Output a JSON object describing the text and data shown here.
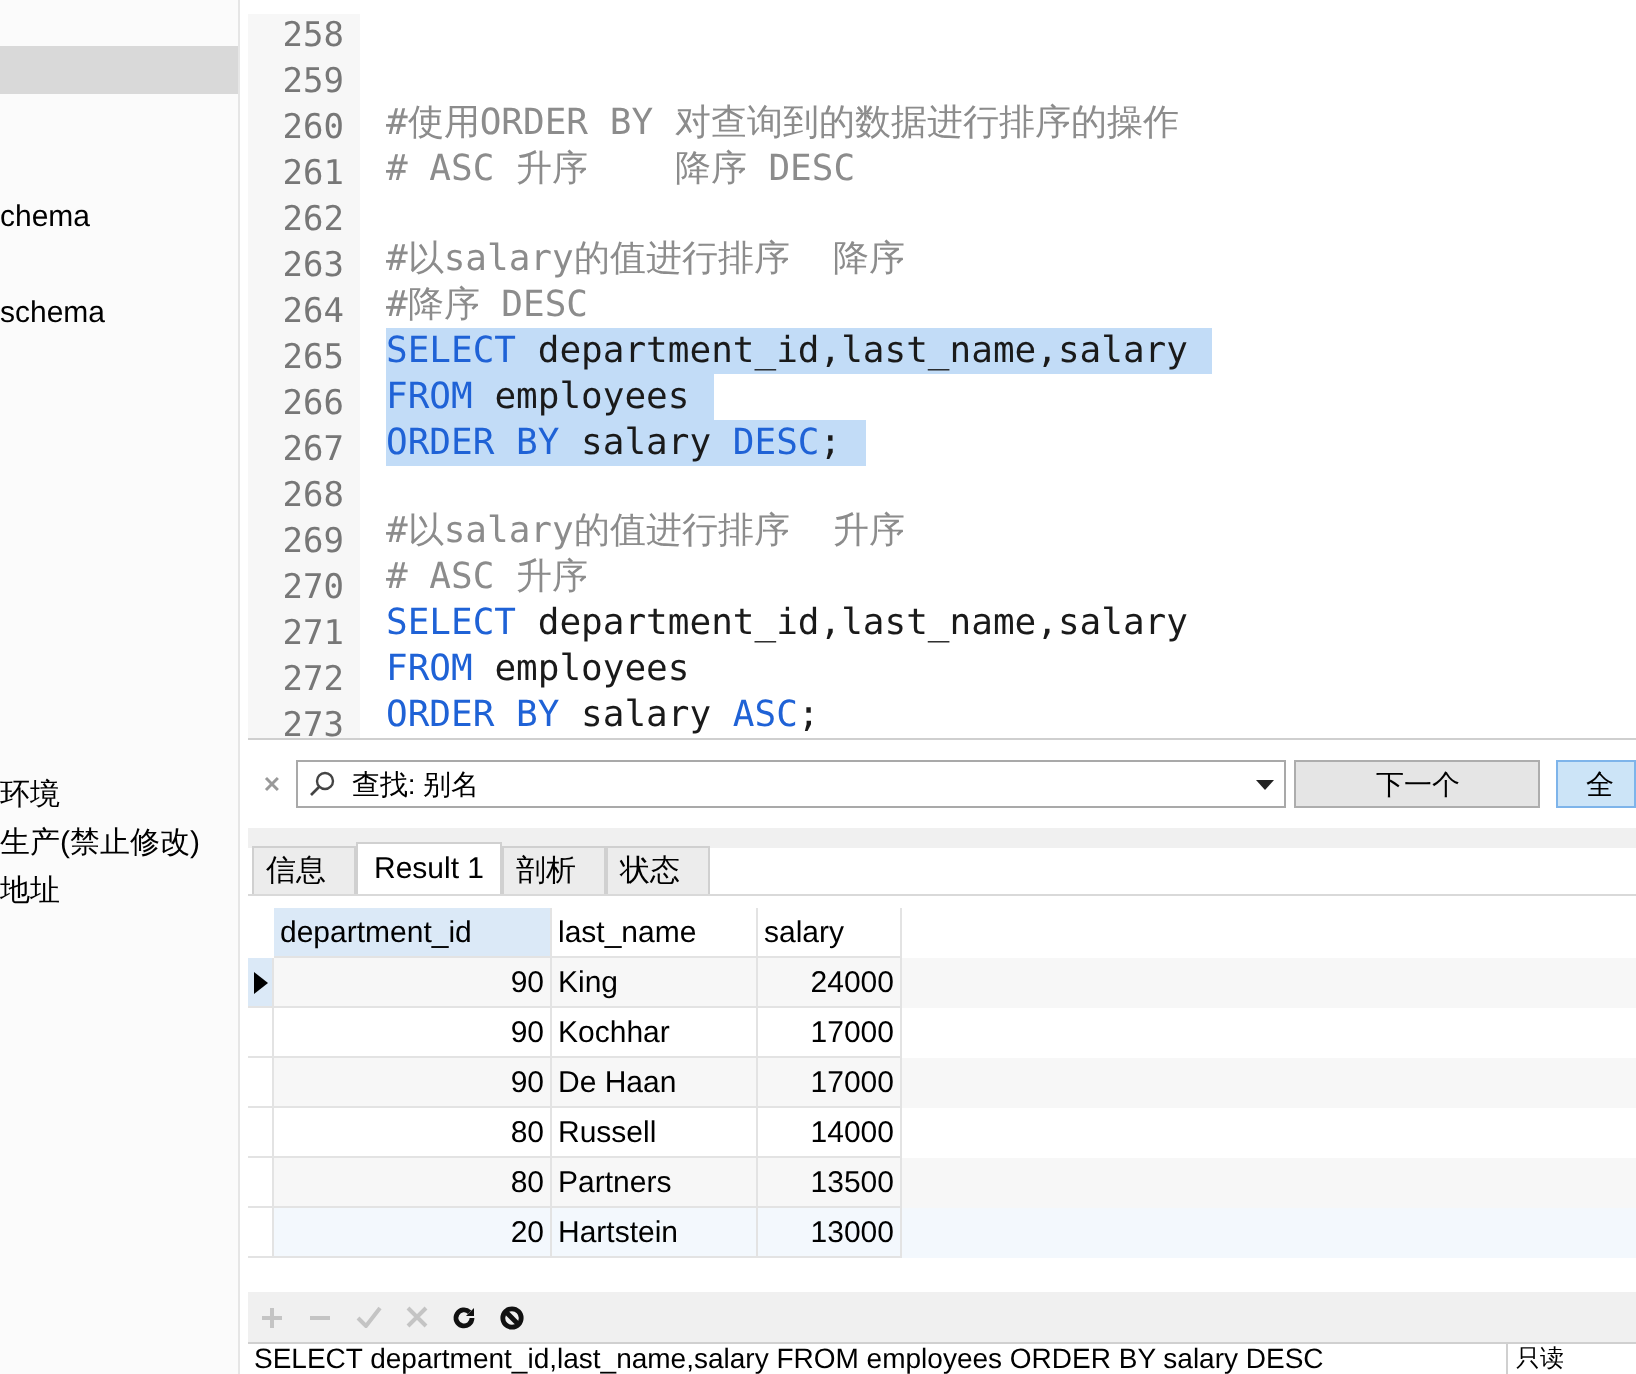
{
  "sidebar": {
    "items": [
      {
        "selected": true
      },
      {
        "label": "chema",
        "selected": false
      },
      {
        "label": "schema",
        "selected": false
      },
      {
        "label": "环境",
        "selected": false
      },
      {
        "label": "生产(禁止修改)",
        "selected": false
      },
      {
        "label": "地址",
        "selected": false
      }
    ]
  },
  "editor": {
    "lines": [
      {
        "number": "258"
      },
      {
        "number": "259"
      },
      {
        "number": "260",
        "selected": false,
        "tokens": [
          {
            "kind": "comment",
            "text": "#使用ORDER BY 对查询到的数据进行排序的操作"
          }
        ]
      },
      {
        "number": "261",
        "selected": false,
        "tokens": [
          {
            "kind": "comment",
            "text": "# ASC 升序    降序 DESC"
          }
        ]
      },
      {
        "number": "262"
      },
      {
        "number": "263",
        "selected": false,
        "tokens": [
          {
            "kind": "comment",
            "text": "#以salary的值进行排序  降序"
          }
        ]
      },
      {
        "number": "264",
        "selected": false,
        "tokens": [
          {
            "kind": "comment",
            "text": "#降序 DESC"
          }
        ]
      },
      {
        "number": "265",
        "selected": true,
        "tokens": [
          {
            "kind": "keyword",
            "text": "SELECT"
          },
          {
            "kind": "plain",
            "text": " department_id,last_name,salary"
          }
        ]
      },
      {
        "number": "266",
        "selected": true,
        "tokens": [
          {
            "kind": "keyword",
            "text": "FROM"
          },
          {
            "kind": "plain",
            "text": " employees"
          }
        ]
      },
      {
        "number": "267",
        "selected": true,
        "tokens": [
          {
            "kind": "keyword",
            "text": "ORDER BY"
          },
          {
            "kind": "plain",
            "text": " salary "
          },
          {
            "kind": "keyword",
            "text": "DESC"
          },
          {
            "kind": "plain",
            "text": ";"
          }
        ]
      },
      {
        "number": "268"
      },
      {
        "number": "269",
        "selected": false,
        "tokens": [
          {
            "kind": "comment",
            "text": "#以salary的值进行排序  升序"
          }
        ]
      },
      {
        "number": "270",
        "selected": false,
        "tokens": [
          {
            "kind": "comment",
            "text": "# ASC 升序"
          }
        ]
      },
      {
        "number": "271",
        "selected": false,
        "tokens": [
          {
            "kind": "keyword",
            "text": "SELECT"
          },
          {
            "kind": "plain",
            "text": " department_id,last_name,salary"
          }
        ]
      },
      {
        "number": "272",
        "selected": false,
        "tokens": [
          {
            "kind": "keyword",
            "text": "FROM"
          },
          {
            "kind": "plain",
            "text": " employees"
          }
        ]
      },
      {
        "number": "273",
        "selected": false,
        "tokens": [
          {
            "kind": "keyword",
            "text": "ORDER BY"
          },
          {
            "kind": "plain",
            "text": " salary "
          },
          {
            "kind": "keyword",
            "text": "ASC"
          },
          {
            "kind": "plain",
            "text": ";"
          }
        ]
      }
    ]
  },
  "find_bar": {
    "value": "查找: 别名",
    "next_button": "下一个",
    "all_button": "全"
  },
  "tabs": [
    {
      "label": "信息",
      "selected": false
    },
    {
      "label": "Result 1",
      "selected": true
    },
    {
      "label": "剖析",
      "selected": false
    },
    {
      "label": "状态",
      "selected": false
    }
  ],
  "table": {
    "columns": [
      {
        "label": "department_id",
        "selected": true
      },
      {
        "label": "last_name",
        "selected": false
      },
      {
        "label": "salary",
        "selected": false
      }
    ],
    "rows": [
      {
        "cells": [
          "90",
          "King",
          "24000"
        ],
        "selected": true
      },
      {
        "cells": [
          "90",
          "Kochhar",
          "17000"
        ],
        "selected": false
      },
      {
        "cells": [
          "90",
          "De Haan",
          "17000"
        ],
        "selected": false
      },
      {
        "cells": [
          "80",
          "Russell",
          "14000"
        ],
        "selected": false
      },
      {
        "cells": [
          "80",
          "Partners",
          "13500"
        ],
        "selected": false
      },
      {
        "cells": [
          "20",
          "Hartstein",
          "13000"
        ],
        "selected": false
      }
    ]
  },
  "toolbar": [
    {
      "kind": "add",
      "disabled": true
    },
    {
      "kind": "remove",
      "disabled": true
    },
    {
      "kind": "apply",
      "disabled": true
    },
    {
      "kind": "discard",
      "disabled": true
    },
    {
      "kind": "refresh",
      "disabled": false
    },
    {
      "kind": "stop",
      "disabled": false
    }
  ],
  "status_bar": {
    "query": "SELECT department_id,last_name,salary FROM employees ORDER BY salary DESC",
    "mode": "只读"
  }
}
